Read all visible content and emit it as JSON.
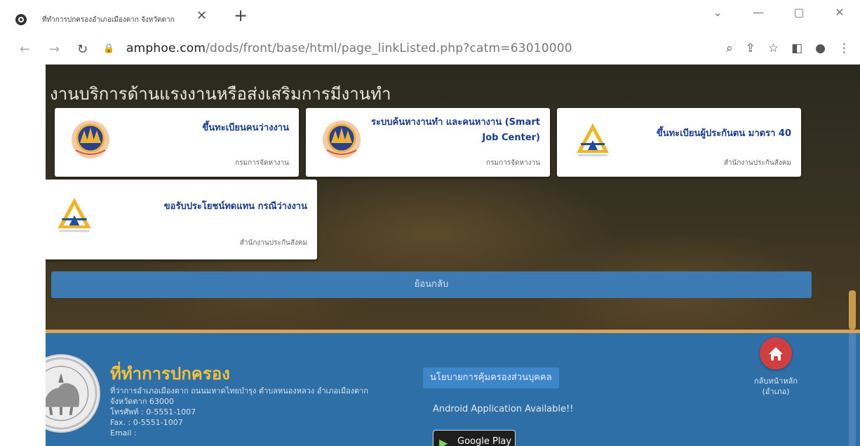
{
  "browser": {
    "tab_title": "ที่ทำการปกครองอำเภอเมืองตาก จังหวัดตาก",
    "tab_close": "✕",
    "new_tab": "+",
    "url_host": "amphoe.com",
    "url_path": "/dods/front/base/html/page_linkListed.php?catm=63010000"
  },
  "section": {
    "title": "งานบริการด้านแรงงานหรือส่งเสริมการมีงานทำ",
    "cards": [
      {
        "title": "ขึ้นทะเบียนคนว่างงาน",
        "org": "กรมการจัดหางาน",
        "logo": "doe-seal"
      },
      {
        "title": "ระบบค้นหางานทำ และคนหางาน (Smart Job Center)",
        "org": "กรมการจัดหางาน",
        "logo": "doe-seal"
      },
      {
        "title": "ขึ้นทะเบียนผู้ประกันตน มาตรา 40",
        "org": "สำนักงานประกันสังคม",
        "logo": "sso-logo"
      },
      {
        "title": "ขอรับประโยชน์ทดแทน กรณีว่างงาน",
        "org": "สำนักงานประกันสังคม",
        "logo": "sso-logo"
      }
    ],
    "back_label": "ย้อนกลับ"
  },
  "footer": {
    "title": "ที่ทำการปกครอง",
    "address": "ที่ว่าการอำเภอเมืองตาก ถนนมหาดไทยบำรุง ตำบลหนองหลวง อำเภอเมืองตาก จังหวัดตาก 63000",
    "tel": "โทรศัพท์ : 0-5551-1007",
    "fax": "Fax. : 0-5551-1007",
    "email": "Email :",
    "policy_label": "นโยบายการคุ้มครองส่วนบุคคล",
    "android_text": "Android Application Available!!",
    "google_play_label": "Google Play",
    "home_label": "กลับหน้าหลัก (อำเภอ)"
  },
  "colors": {
    "accent_blue": "#2f6fa7",
    "card_title": "#1b3b8c",
    "footer_title": "#f5c13d",
    "home_button": "#cf3f3f",
    "footer_line": "#d6a55a"
  }
}
